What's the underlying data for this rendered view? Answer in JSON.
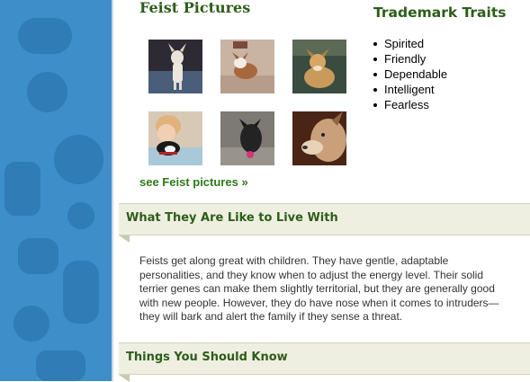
{
  "pictures": {
    "title": "Feist Pictures",
    "link_label": "see Feist pictures »",
    "thumbnails": [
      {
        "icon": "dog-photo-1"
      },
      {
        "icon": "dog-photo-2"
      },
      {
        "icon": "dog-photo-3"
      },
      {
        "icon": "dog-photo-4"
      },
      {
        "icon": "dog-photo-5"
      },
      {
        "icon": "dog-photo-6"
      }
    ]
  },
  "traits": {
    "title": "Trademark Traits",
    "items": [
      "Spirited",
      "Friendly",
      "Dependable",
      "Intelligent",
      "Fearless"
    ]
  },
  "sections": {
    "live_with": {
      "title": "What They Are Like to Live With",
      "body": "Feists get along great with children. They have gentle, adaptable personalities, and they know when to adjust the energy level. Their solid terrier genes can make them slightly territorial, but they are generally good with new people. However, they do have nose when it comes to intruders—they will bark and alert the family if they sense a threat."
    },
    "should_know": {
      "title": "Things You Should Know"
    }
  },
  "colors": {
    "background_pattern": "#3d8ec9",
    "heading_green": "#2d5d1a",
    "link_green": "#2d7a1a",
    "section_bar": "#efefe1"
  }
}
